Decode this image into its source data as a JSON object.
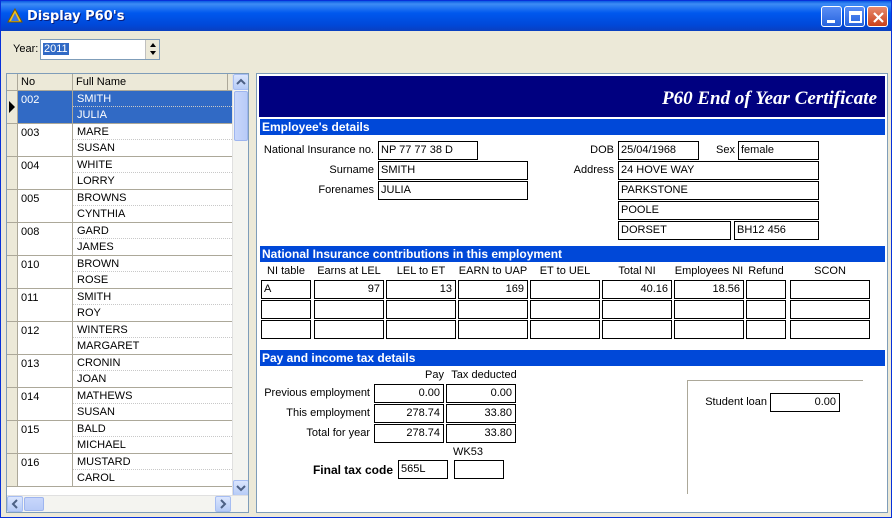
{
  "window": {
    "title": "Display P60's"
  },
  "year": {
    "label": "Year:",
    "value": "2011"
  },
  "list": {
    "columns": [
      "No",
      "Full Name",
      ""
    ],
    "rows": [
      {
        "no": "002",
        "surname": "SMITH",
        "forename": "JULIA",
        "selected": true
      },
      {
        "no": "003",
        "surname": "MARE",
        "forename": "SUSAN"
      },
      {
        "no": "004",
        "surname": "WHITE",
        "forename": "LORRY"
      },
      {
        "no": "005",
        "surname": "BROWNS",
        "forename": "CYNTHIA"
      },
      {
        "no": "008",
        "surname": "GARD",
        "forename": "JAMES"
      },
      {
        "no": "010",
        "surname": "BROWN",
        "forename": "ROSE"
      },
      {
        "no": "011",
        "surname": "SMITH",
        "forename": "ROY"
      },
      {
        "no": "012",
        "surname": "WINTERS",
        "forename": "MARGARET"
      },
      {
        "no": "013",
        "surname": "CRONIN",
        "forename": "JOAN"
      },
      {
        "no": "014",
        "surname": "MATHEWS",
        "forename": "SUSAN"
      },
      {
        "no": "015",
        "surname": "BALD",
        "forename": "MICHAEL"
      },
      {
        "no": "016",
        "surname": "MUSTARD",
        "forename": "CAROL"
      }
    ]
  },
  "certificate": {
    "title": "P60 End of Year Certificate",
    "employee": {
      "section_title": "Employee's details",
      "ni_label": "National Insurance no.",
      "ni_value": "NP 77 77 38 D",
      "surname_label": "Surname",
      "surname_value": "SMITH",
      "forenames_label": "Forenames",
      "forenames_value": "JULIA",
      "dob_label": "DOB",
      "dob_value": "25/04/1968",
      "sex_label": "Sex",
      "sex_value": "female",
      "address_label": "Address",
      "address_line1": "24 HOVE WAY",
      "address_line2": "PARKSTONE",
      "address_line3": "POOLE",
      "address_line4": "DORSET",
      "postcode": "BH12 456"
    },
    "ni": {
      "section_title": "National Insurance contributions in this employment",
      "headers": [
        "NI table",
        "Earns at LEL",
        "LEL to ET",
        "EARN to UAP",
        "ET to UEL",
        "Total NI",
        "Employees NI",
        "Refund",
        "SCON"
      ],
      "row1": [
        "A",
        "97",
        "13",
        "169",
        "",
        "40.16",
        "18.56",
        "",
        ""
      ]
    },
    "tax": {
      "section_title": "Pay and income tax details",
      "pay_header": "Pay",
      "tax_header": "Tax deducted",
      "prev_label": "Previous employment",
      "prev_pay": "0.00",
      "prev_tax": "0.00",
      "this_label": "This employment",
      "this_pay": "278.74",
      "this_tax": "33.80",
      "total_label": "Total for year",
      "total_pay": "278.74",
      "total_tax": "33.80",
      "wk53_label": "WK53",
      "final_label": "Final tax code",
      "final_value": "565L",
      "wk53_value": "",
      "loan_label": "Student loan",
      "loan_value": "0.00"
    }
  },
  "colors": {
    "title_bar": "#0058ee",
    "banner": "#000080",
    "section": "#0048d8",
    "selection": "#316ac5"
  }
}
